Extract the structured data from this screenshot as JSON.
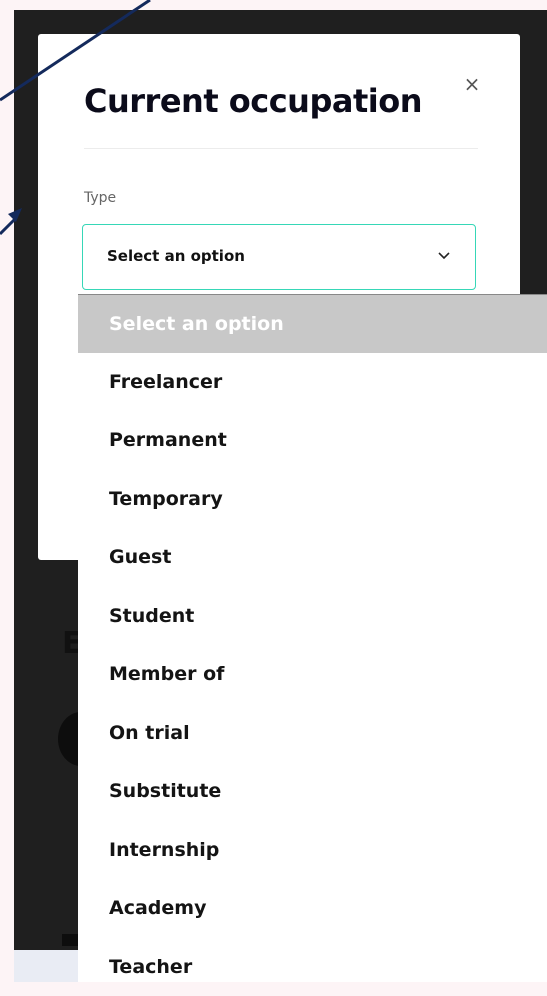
{
  "modal": {
    "title": "Current occupation",
    "close_label": "×",
    "field_label": "Type",
    "select_value": "Select an option"
  },
  "dropdown": {
    "options": [
      "Select an option",
      "Freelancer",
      "Permanent",
      "Temporary",
      "Guest",
      "Student",
      "Member of",
      "On trial",
      "Substitute",
      "Internship",
      "Academy",
      "Teacher"
    ],
    "selected_index": 0
  },
  "background": {
    "partial_letter": "E"
  },
  "colors": {
    "focus_border": "#36d7b7",
    "highlight": "#c8c8c8",
    "arrow": "#142a5c",
    "backdrop": "#1f1f1f"
  },
  "icons": {
    "close": "close-icon",
    "chevron": "chevron-down-icon",
    "arrow": "annotation-arrow"
  }
}
